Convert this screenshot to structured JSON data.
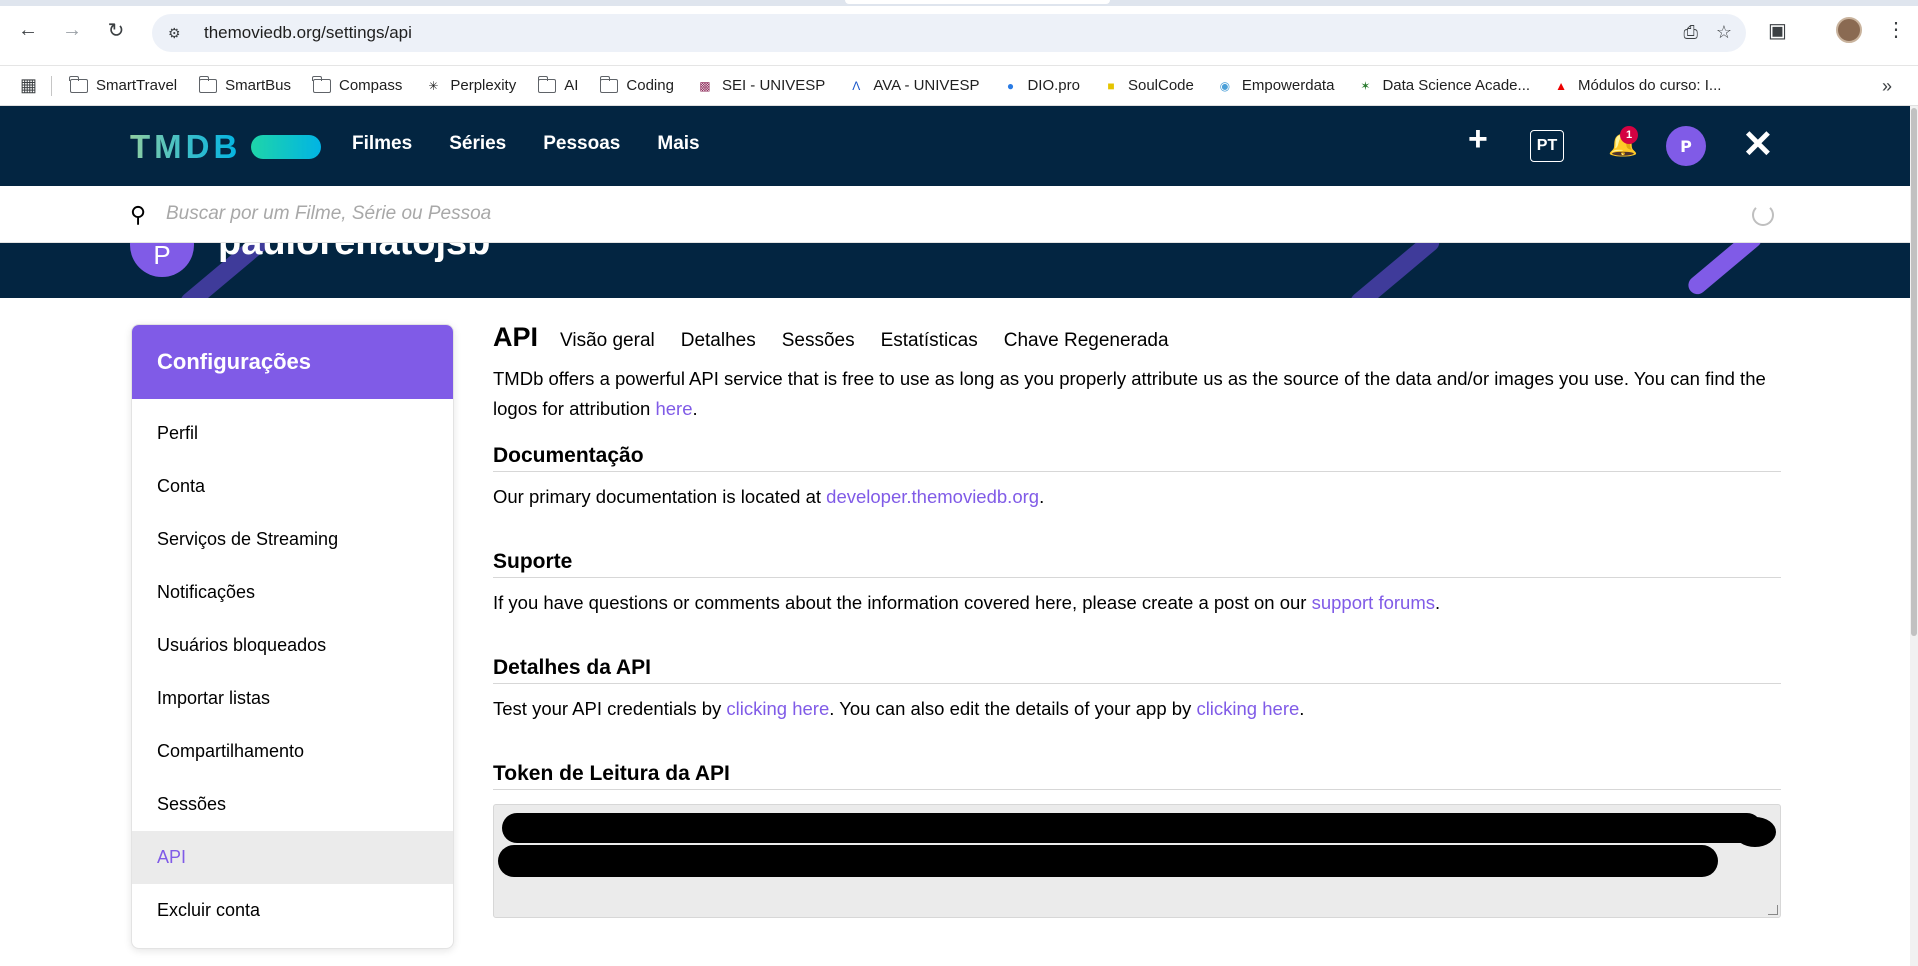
{
  "browser": {
    "url": "themoviedb.org/settings/api",
    "bookmarks": [
      {
        "label": "SmartTravel",
        "icon": "folder-icon"
      },
      {
        "label": "SmartBus",
        "icon": "folder-icon"
      },
      {
        "label": "Compass",
        "icon": "folder-icon"
      },
      {
        "label": "Perplexity",
        "icon": "perplexity-icon"
      },
      {
        "label": "AI",
        "icon": "folder-icon"
      },
      {
        "label": "Coding",
        "icon": "folder-icon"
      },
      {
        "label": "SEI - UNIVESP",
        "icon": "sei-icon"
      },
      {
        "label": "AVA - UNIVESP",
        "icon": "ava-icon"
      },
      {
        "label": "DIO.pro",
        "icon": "dio-icon"
      },
      {
        "label": "SoulCode",
        "icon": "soulcode-icon"
      },
      {
        "label": "Empowerdata",
        "icon": "empowerdata-icon"
      },
      {
        "label": "Data Science Acade...",
        "icon": "datascience-icon"
      },
      {
        "label": "Módulos do curso: I...",
        "icon": "santander-icon"
      }
    ]
  },
  "header": {
    "logo": "TMDB",
    "nav": [
      "Filmes",
      "Séries",
      "Pessoas",
      "Mais"
    ],
    "language": "PT",
    "notification_count": "1",
    "avatar_initial": "P"
  },
  "search": {
    "placeholder": "Buscar por um Filme, Série ou Pessoa"
  },
  "profile": {
    "initial": "P",
    "username": "paulorenatojsb"
  },
  "sidebar": {
    "title": "Configurações",
    "items": [
      {
        "label": "Perfil"
      },
      {
        "label": "Conta"
      },
      {
        "label": "Serviços de Streaming"
      },
      {
        "label": "Notificações"
      },
      {
        "label": "Usuários bloqueados"
      },
      {
        "label": "Importar listas"
      },
      {
        "label": "Compartilhamento"
      },
      {
        "label": "Sessões"
      },
      {
        "label": "API"
      },
      {
        "label": "Excluir conta"
      }
    ],
    "active": "API"
  },
  "main": {
    "title": "API",
    "tabs": [
      "Visão geral",
      "Detalhes",
      "Sessões",
      "Estatísticas",
      "Chave Regenerada"
    ],
    "intro_text": "TMDb offers a powerful API service that is free to use as long as you properly attribute us as the source of the data and/or images you use. You can find the logos for attribution ",
    "intro_link": "here",
    "sections": {
      "docs": {
        "title": "Documentação",
        "text": "Our primary documentation is located at ",
        "link": "developer.themoviedb.org"
      },
      "support": {
        "title": "Suporte",
        "text": "If you have questions or comments about the information covered here, please create a post on our ",
        "link": "support forums"
      },
      "api_details": {
        "title": "Detalhes da API",
        "text1": "Test your API credentials by ",
        "link1": "clicking here",
        "text2": ". You can also edit the details of your app by ",
        "link2": "clicking here"
      },
      "token": {
        "title": "Token de Leitura da API"
      }
    }
  },
  "colors": {
    "tmdb_dark_blue": "#032541",
    "accent_purple": "#805be7",
    "notification_red": "#d40242"
  }
}
